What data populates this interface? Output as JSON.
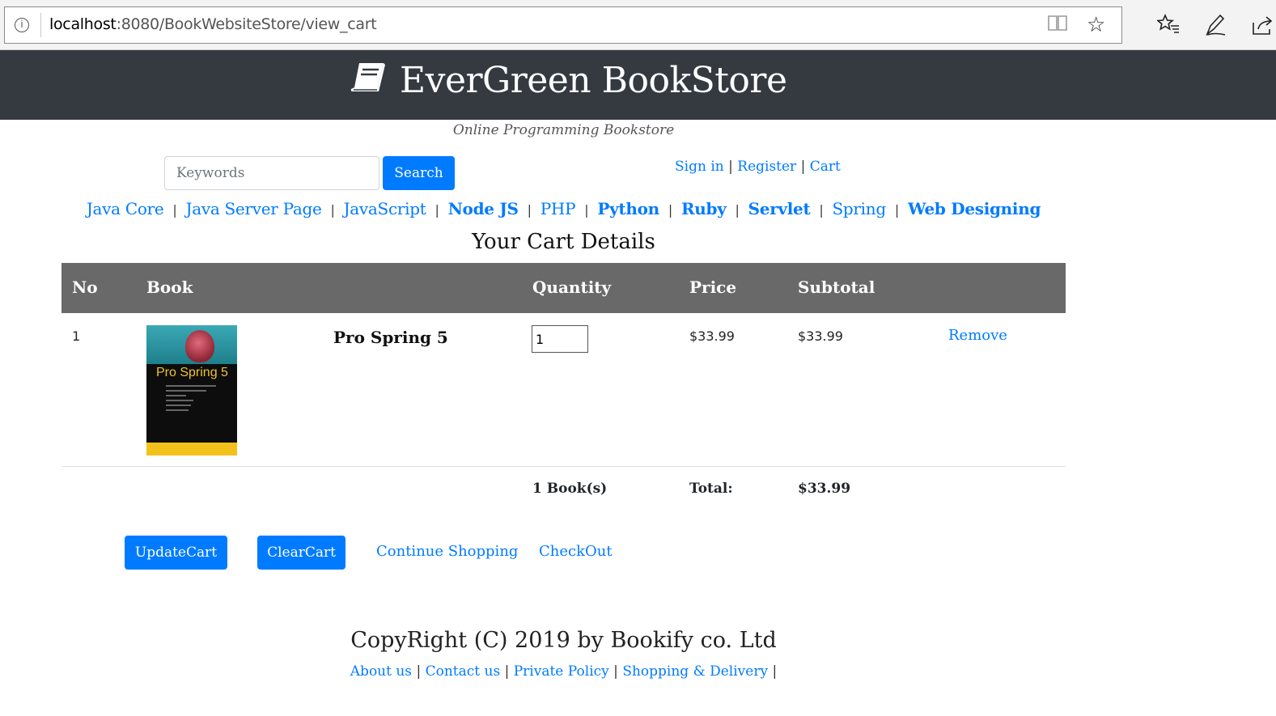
{
  "browser": {
    "url_host": "localhost",
    "url_rest": ":8080/BookWebsiteStore/view_cart",
    "icons": [
      "info-icon",
      "reading-view-icon",
      "favorite-star-icon",
      "favorites-list-icon",
      "pen-icon",
      "share-icon"
    ]
  },
  "header": {
    "title": "EverGreen BookStore",
    "tagline": "Online Programming Bookstore",
    "logo_icon": "book-icon"
  },
  "search": {
    "placeholder": "Keywords",
    "button_label": "Search"
  },
  "account": {
    "sign_in": "Sign in",
    "register": "Register",
    "cart": "Cart",
    "separator": "|"
  },
  "categories": [
    {
      "label": "Java Core"
    },
    {
      "label": "Java Server Page"
    },
    {
      "label": "JavaScript"
    },
    {
      "label": "Node JS"
    },
    {
      "label": "PHP"
    },
    {
      "label": "Python"
    },
    {
      "label": "Ruby"
    },
    {
      "label": "Servlet"
    },
    {
      "label": "Spring"
    },
    {
      "label": "Web Designing"
    }
  ],
  "category_separator": "|",
  "cart": {
    "heading": "Your Cart Details",
    "columns": [
      "No",
      "Book",
      "Quantity",
      "Price",
      "Subtotal"
    ],
    "rows": [
      {
        "no": "1",
        "title": "Pro Spring 5",
        "cover_text": "Pro Spring 5",
        "quantity": "1",
        "price": "$33.99",
        "subtotal": "$33.99",
        "remove_label": "Remove"
      }
    ],
    "total_books": "1 Book(s)",
    "total_label": "Total:",
    "total_value": "$33.99"
  },
  "actions": {
    "update_label": "UpdateCart",
    "clear_label": "ClearCart",
    "continue_label": "Continue Shopping",
    "checkout_label": "CheckOut"
  },
  "footer": {
    "copyright": "CopyRight (C) 2019 by Bookify co. Ltd",
    "links": [
      "About us",
      "Contact us",
      "Private Policy",
      "Shopping & Delivery"
    ],
    "separator": "|"
  },
  "colors": {
    "header_bg": "#343a40",
    "primary": "#007bff",
    "table_header_bg": "#696969"
  }
}
